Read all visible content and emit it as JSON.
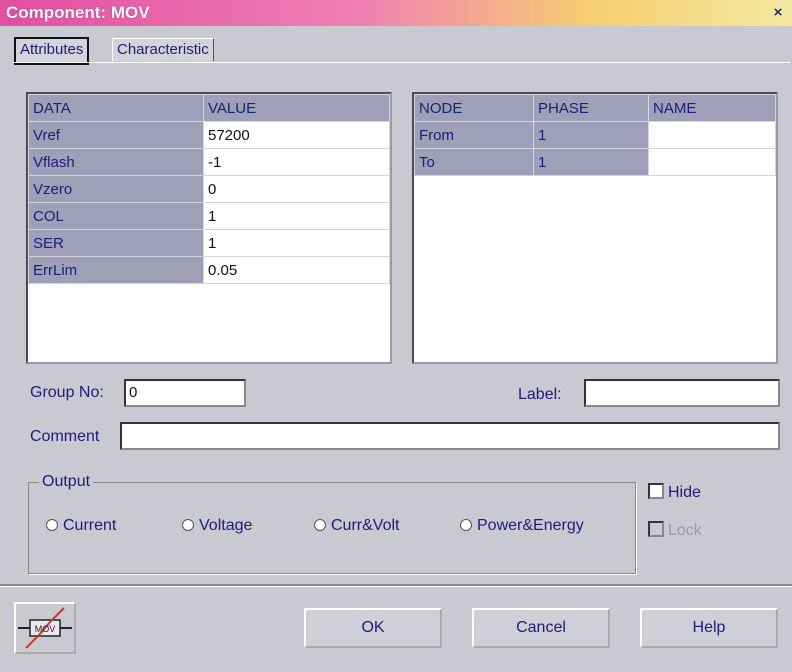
{
  "window": {
    "title": "Component: MOV",
    "close_symbol": "×"
  },
  "tabs": [
    {
      "label": "Attributes",
      "active": true
    },
    {
      "label": "Characteristic",
      "active": false
    }
  ],
  "data_table": {
    "headers": [
      "DATA",
      "VALUE"
    ],
    "rows": [
      {
        "name": "Vref",
        "value": "57200"
      },
      {
        "name": "Vflash",
        "value": "-1"
      },
      {
        "name": "Vzero",
        "value": "0"
      },
      {
        "name": "COL",
        "value": "1"
      },
      {
        "name": "SER",
        "value": "1"
      },
      {
        "name": "ErrLim",
        "value": "0.05"
      }
    ]
  },
  "node_table": {
    "headers": [
      "NODE",
      "PHASE",
      "NAME"
    ],
    "rows": [
      {
        "node": "From",
        "phase": "1",
        "name": ""
      },
      {
        "node": "To",
        "phase": "1",
        "name": ""
      }
    ]
  },
  "fields": {
    "group_no_label": "Group No:",
    "group_no_value": "0",
    "label_label": "Label:",
    "label_value": "",
    "comment_label": "Comment",
    "comment_value": ""
  },
  "output": {
    "legend": "Output",
    "options": [
      "Current",
      "Voltage",
      "Curr&Volt",
      "Power&Energy"
    ]
  },
  "checkboxes": {
    "hide": "Hide",
    "lock": "Lock"
  },
  "buttons": {
    "ok": "OK",
    "cancel": "Cancel",
    "help": "Help"
  },
  "icon": {
    "name": "mov-icon",
    "text": "MOV",
    "accent": "#c0392b"
  }
}
